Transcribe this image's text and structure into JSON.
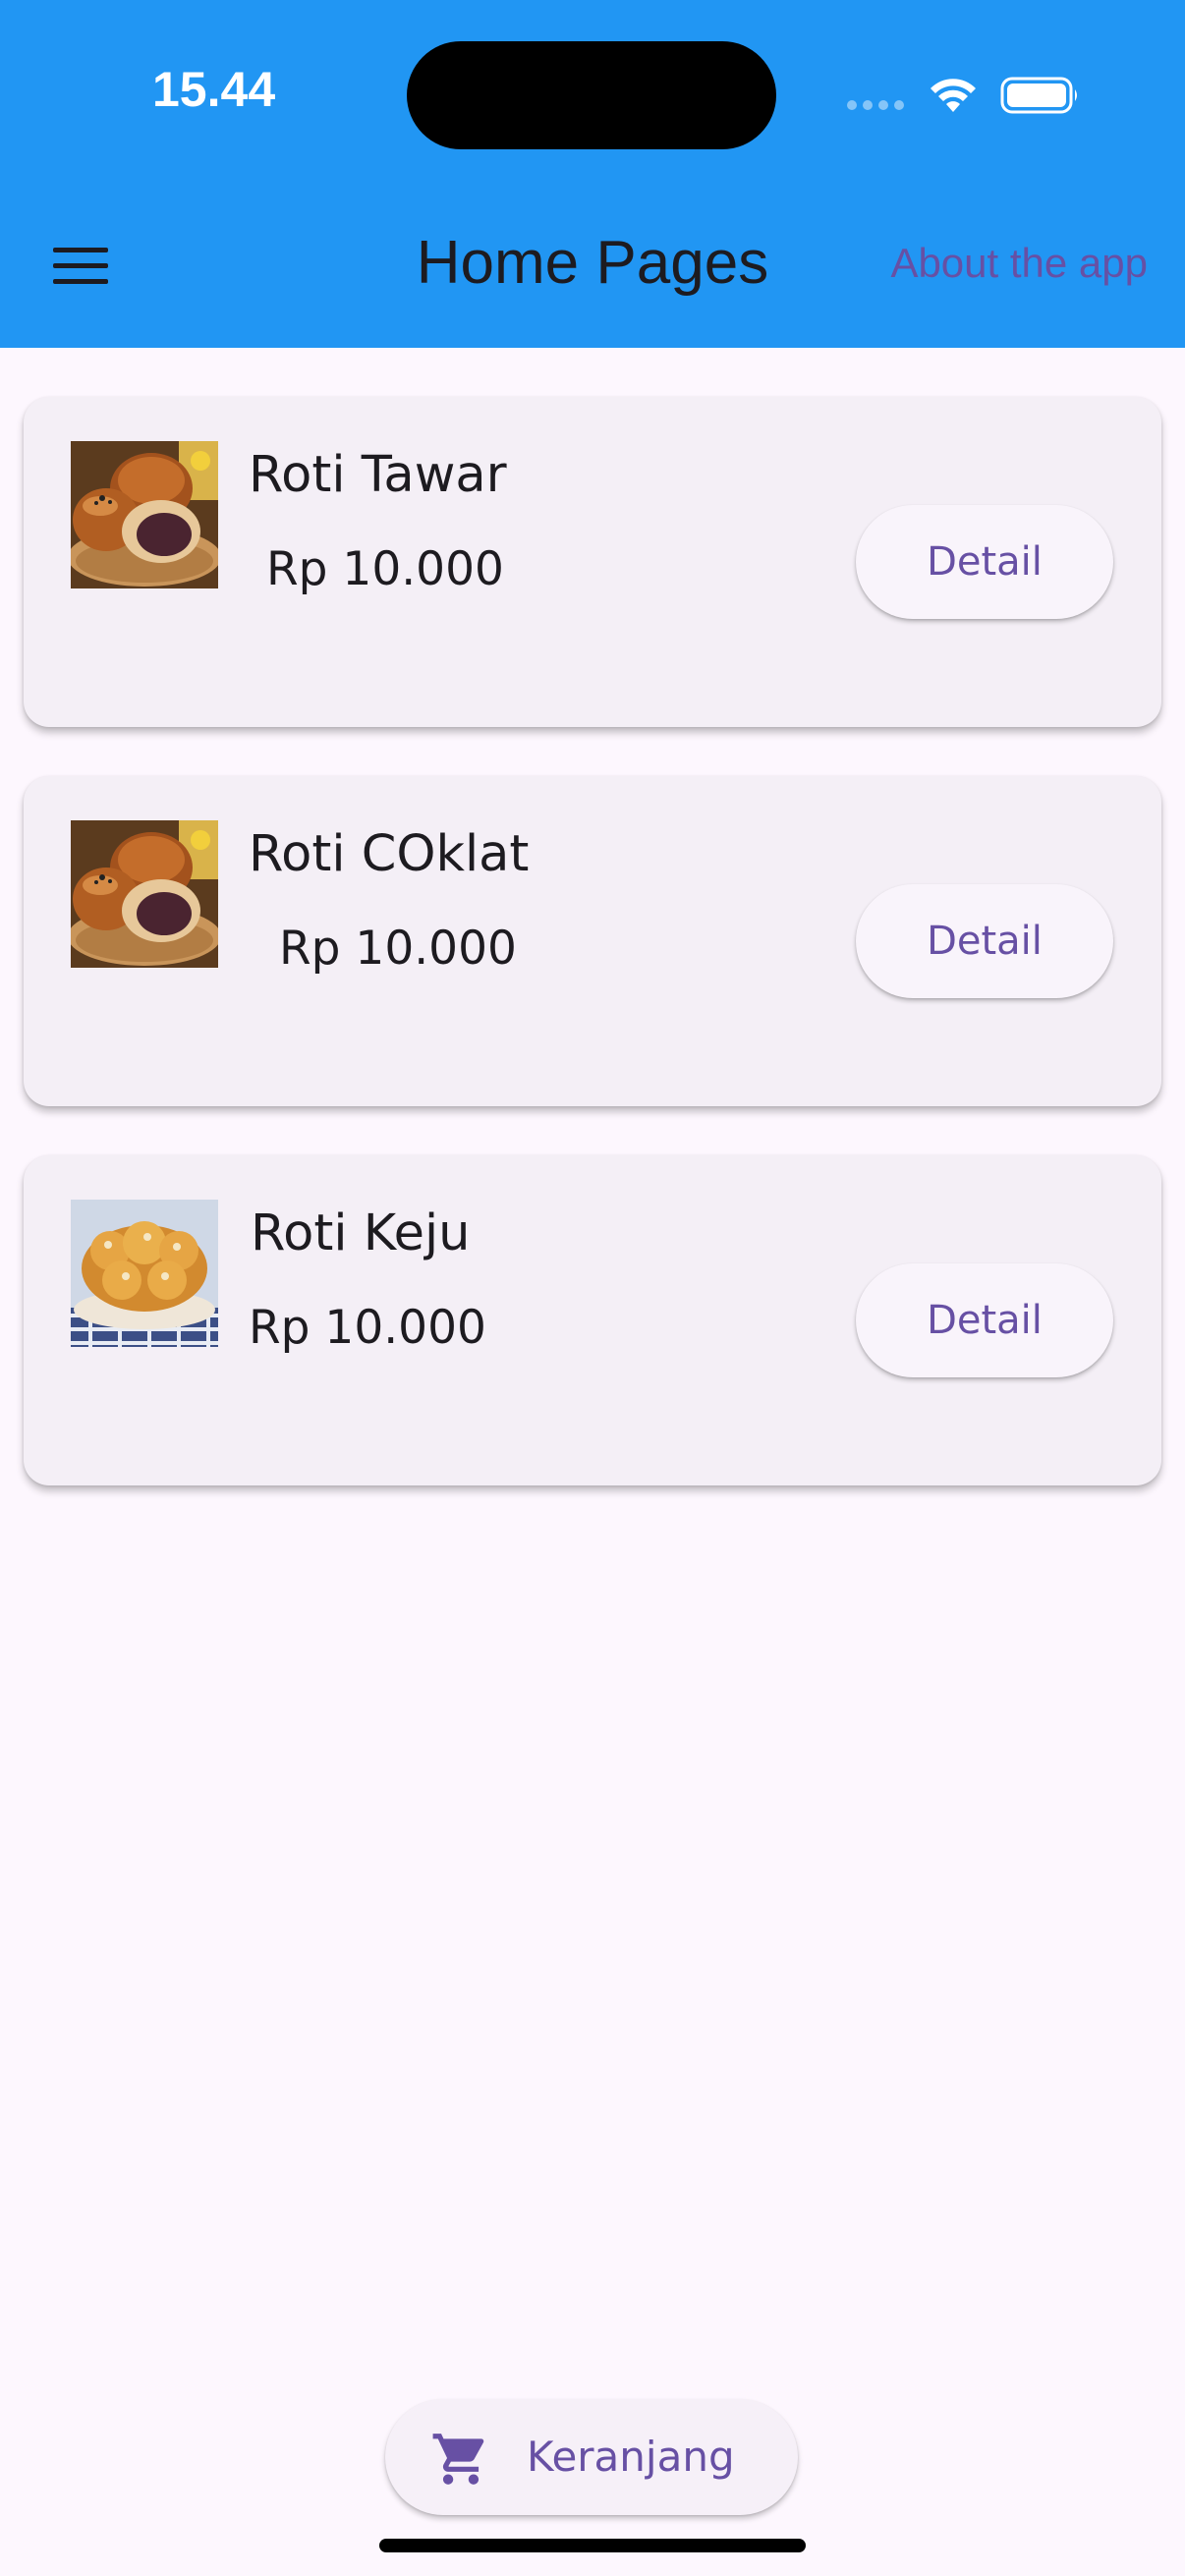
{
  "status_bar": {
    "time": "15.44"
  },
  "app_bar": {
    "title": "Home Pages",
    "action_label": "About the app",
    "menu_icon": "hamburger-menu-icon",
    "background_color": "#2196f3"
  },
  "products": [
    {
      "name": "Roti Tawar",
      "price": "Rp 10.000",
      "button_label": "Detail",
      "image": "round-bread-buns-with-filling"
    },
    {
      "name": "Roti COklat",
      "price": "Rp 10.000",
      "button_label": "Detail",
      "image": "round-bread-buns-with-filling"
    },
    {
      "name": "Roti Keju",
      "price": "Rp 10.000",
      "button_label": "Detail",
      "image": "cheese-pull-apart-bread"
    }
  ],
  "cart_button": {
    "label": "Keranjang",
    "icon": "shopping-cart-icon"
  },
  "colors": {
    "accent": "#6750a4",
    "background": "#fdf7fe",
    "card": "#f4eff6"
  }
}
